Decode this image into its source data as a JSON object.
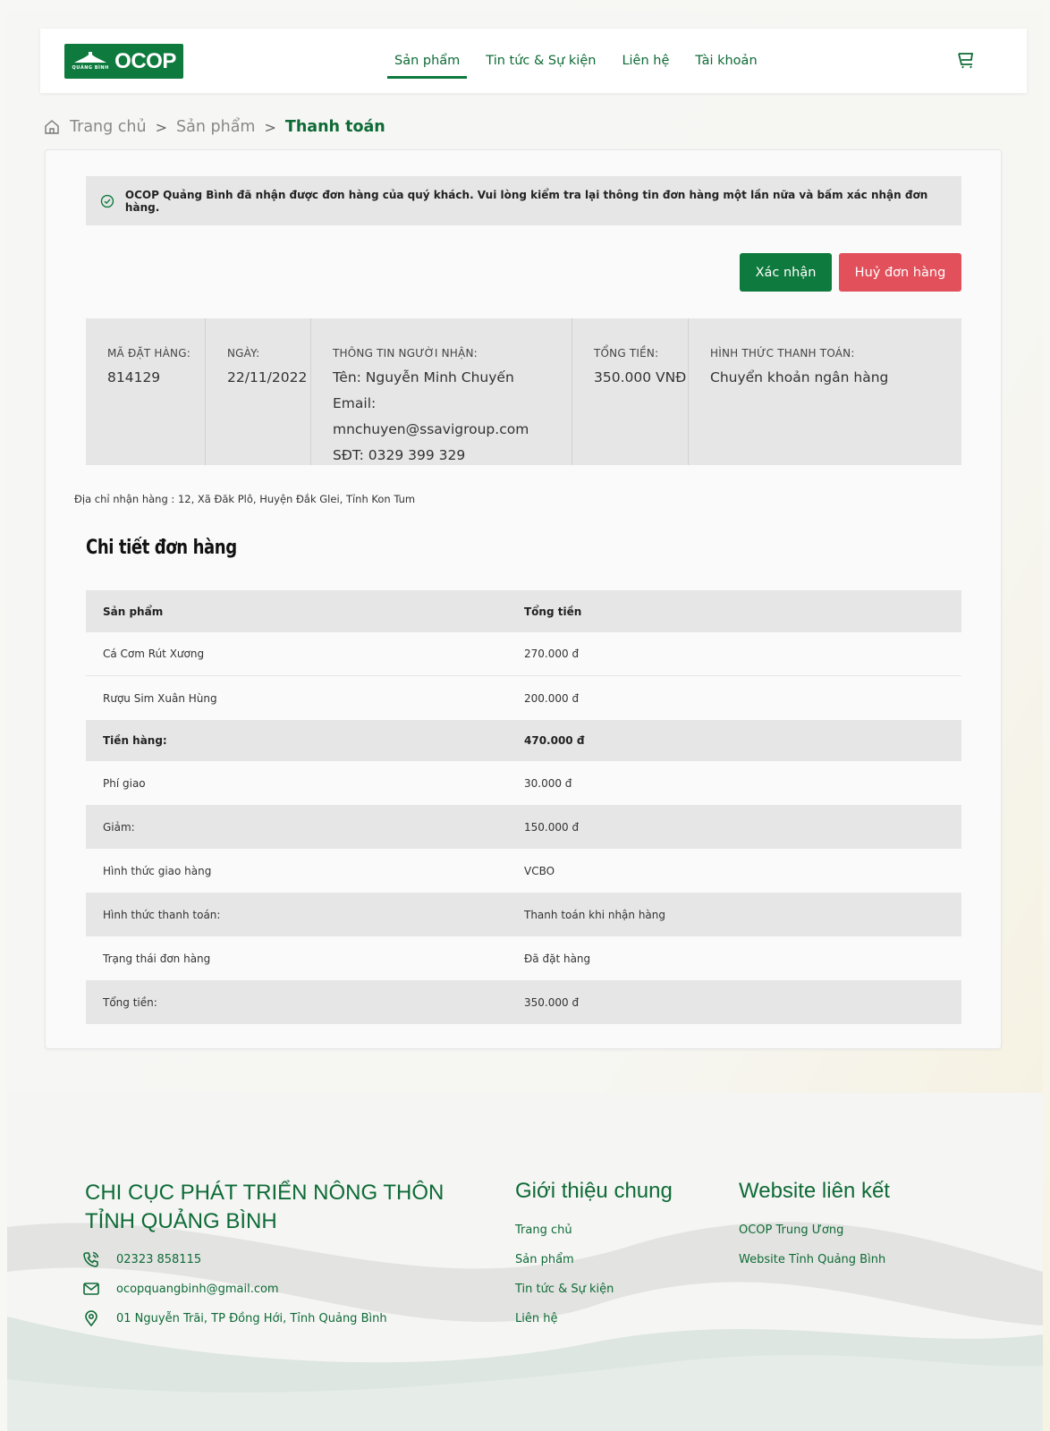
{
  "header": {
    "logo_text": "OCOP",
    "logo_sub": "QUẢNG BÌNH",
    "nav": [
      "Sản phẩm",
      "Tin tức & Sự kiện",
      "Liên hệ",
      "Tài khoản"
    ]
  },
  "breadcrumb": {
    "home": "Trang chủ",
    "products": "Sản phẩm",
    "current": "Thanh toán",
    "separator": ">"
  },
  "notice": {
    "text": "OCOP Quảng Bình đã nhận được đơn hàng của quý khách. Vui lòng kiểm tra lại thông tin đơn hàng một lần nữa và bấm xác nhận đơn hàng."
  },
  "actions": {
    "confirm": "Xác nhận",
    "cancel": "Huỷ đơn hàng"
  },
  "order_info": {
    "order_id_label": "MÃ ĐẶT HÀNG:",
    "order_id": "814129",
    "date_label": "NGÀY:",
    "date": "22/11/2022",
    "recipient_label": "THÔNG TIN NGƯỜI NHẬN:",
    "recipient_name": "Tên: Nguyễn Minh Chuyến",
    "recipient_email": "Email: mnchuyen@ssavigroup.com",
    "recipient_phone": "SĐT: 0329 399 329",
    "total_label": "TỔNG TIỀN:",
    "total": "350.000 VNĐ",
    "payment_label": "HÌNH THỨC THANH TOÁN:",
    "payment": "Chuyển khoản ngân hàng"
  },
  "address": "Địa chỉ nhận hàng : 12, Xã Đăk Plô, Huyện Đắk Glei, Tỉnh Kon Tum",
  "details": {
    "title": "Chi tiết đơn hàng",
    "header": [
      "Sản phẩm",
      "Tổng tiền"
    ],
    "rows": [
      [
        "Cá Cơm Rút Xương",
        "270.000 đ"
      ],
      [
        "Rượu Sim Xuân Hùng",
        "200.000 đ"
      ],
      [
        "Tiền hàng:",
        "470.000 đ"
      ],
      [
        "Phí giao",
        "30.000 đ"
      ],
      [
        "Giảm:",
        "150.000 đ"
      ],
      [
        "Hình thức giao hàng",
        "VCBO"
      ],
      [
        "Hình thức thanh toán:",
        "Thanh toán khi nhận hàng"
      ],
      [
        "Trạng thái đơn hàng",
        "Đã đặt hàng"
      ],
      [
        "Tổng tiền:",
        "350.000 đ"
      ]
    ]
  },
  "footer": {
    "org_line1": "CHI CỤC PHÁT TRIỂN NÔNG THÔN",
    "org_line2": "TỈNH QUẢNG BÌNH",
    "phone": "02323 858115",
    "email": "ocopquangbinh@gmail.com",
    "address": "01 Nguyễn Trãi, TP Đồng Hới, Tỉnh Quảng Bình",
    "about_title": "Giới thiệu chung",
    "about_links": [
      "Trang chủ",
      "Sản phẩm",
      "Tin tức & Sự kiện",
      "Liên hệ"
    ],
    "links_title": "Website liên kết",
    "links": [
      "OCOP Trung Ương",
      "Website Tỉnh Quảng Bình"
    ]
  },
  "colors": {
    "brand_green": "#0e7a3d",
    "danger_red": "#e2505b"
  }
}
